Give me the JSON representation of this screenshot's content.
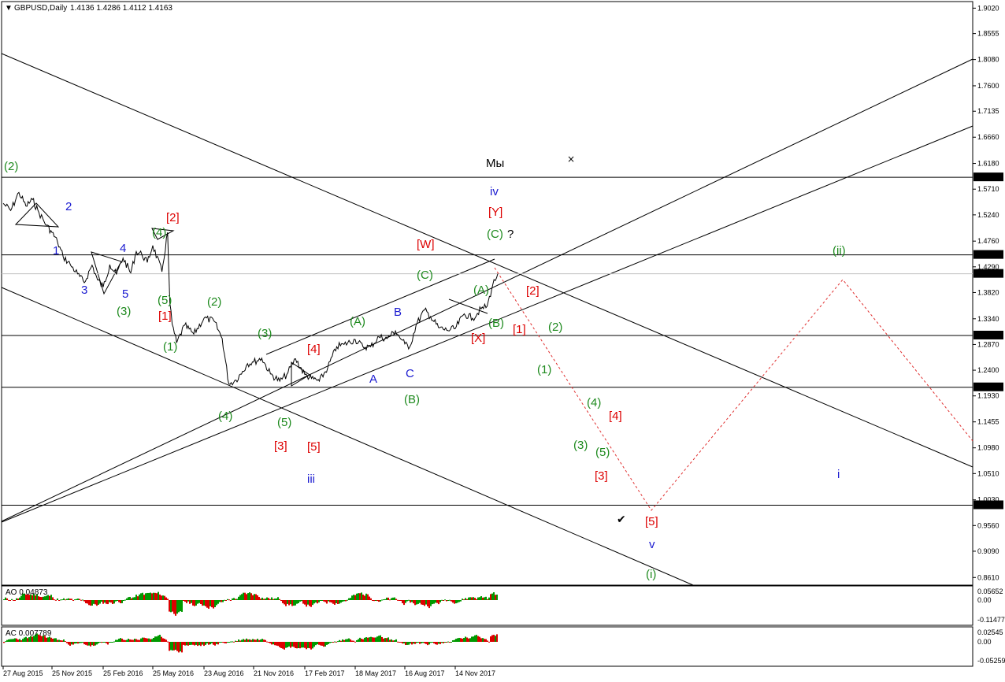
{
  "header": {
    "symbol": "GBPUSD,Daily",
    "ohlc": "1.4136 1.4286 1.4112 1.4163"
  },
  "colors": {
    "price_line": "#000000",
    "bullish_bar": "#009900",
    "bearish_bar": "#dd0000",
    "label_green": "#1e8a1e",
    "label_red": "#dd0000",
    "label_blue": "#1a1ad0",
    "forecast_line": "#e03030",
    "marker_bg": "#000000",
    "marker_text": "#ffffff"
  },
  "chart_data": {
    "type": "line",
    "title": "GBPUSD,Daily",
    "yaxis": {
      "range": [
        0.847,
        1.914
      ],
      "ticks": [
        "1.9020",
        "1.8555",
        "1.8080",
        "1.7600",
        "1.7135",
        "1.6660",
        "1.6180",
        "1.5710",
        "1.5240",
        "1.4760",
        "1.4290",
        "1.3820",
        "1.3340",
        "1.2870",
        "1.2400",
        "1.1930",
        "1.1455",
        "1.0980",
        "1.0510",
        "1.0030",
        "0.9560",
        "0.9090",
        "0.8610"
      ]
    },
    "xaxis": {
      "ticks": [
        "27 Aug 2015",
        "25 Nov 2015",
        "25 Feb 2016",
        "25 May 2016",
        "23 Aug 2016",
        "21 Nov 2016",
        "17 Feb 2017",
        "18 May 2017",
        "16 Aug 2017",
        "14 Nov 2017"
      ]
    },
    "price_series": {
      "name": "GBPUSD",
      "points": [
        [
          "27 Aug 2015",
          1.545
        ],
        [
          "10 Sep 2015",
          1.532
        ],
        [
          "25 Sep 2015",
          1.565
        ],
        [
          "08 Oct 2015",
          1.54
        ],
        [
          "20 Oct 2015",
          1.552
        ],
        [
          "01 Nov 2015",
          1.528
        ],
        [
          "15 Nov 2015",
          1.505
        ],
        [
          "25 Nov 2015",
          1.492
        ],
        [
          "05 Dec 2015",
          1.474
        ],
        [
          "15 Dec 2015",
          1.448
        ],
        [
          "28 Dec 2015",
          1.433
        ],
        [
          "10 Jan 2016",
          1.416
        ],
        [
          "22 Jan 2016",
          1.4
        ],
        [
          "05 Feb 2016",
          1.432
        ],
        [
          "15 Feb 2016",
          1.405
        ],
        [
          "25 Feb 2016",
          1.392
        ],
        [
          "08 Mar 2016",
          1.433
        ],
        [
          "20 Mar 2016",
          1.415
        ],
        [
          "01 Apr 2016",
          1.445
        ],
        [
          "15 Apr 2016",
          1.418
        ],
        [
          "25 Apr 2016",
          1.457
        ],
        [
          "05 May 2016",
          1.452
        ],
        [
          "15 May 2016",
          1.437
        ],
        [
          "25 May 2016",
          1.468
        ],
        [
          "10 Jun 2016",
          1.42
        ],
        [
          "20 Jun 2016",
          1.492
        ],
        [
          "24 Jun 2016",
          1.362
        ],
        [
          "28 Jun 2016",
          1.324
        ],
        [
          "06 Jul 2016",
          1.29
        ],
        [
          "20 Jul 2016",
          1.322
        ],
        [
          "05 Aug 2016",
          1.306
        ],
        [
          "23 Aug 2016",
          1.335
        ],
        [
          "10 Sep 2016",
          1.33
        ],
        [
          "25 Sep 2016",
          1.298
        ],
        [
          "07 Oct 2016",
          1.215
        ],
        [
          "20 Oct 2016",
          1.222
        ],
        [
          "01 Nov 2016",
          1.238
        ],
        [
          "10 Nov 2016",
          1.252
        ],
        [
          "21 Nov 2016",
          1.255
        ],
        [
          "05 Dec 2016",
          1.262
        ],
        [
          "20 Dec 2016",
          1.233
        ],
        [
          "05 Jan 2017",
          1.22
        ],
        [
          "17 Jan 2017",
          1.232
        ],
        [
          "01 Feb 2017",
          1.261
        ],
        [
          "17 Feb 2017",
          1.232
        ],
        [
          "01 Mar 2017",
          1.225
        ],
        [
          "15 Mar 2017",
          1.22
        ],
        [
          "30 Mar 2017",
          1.245
        ],
        [
          "15 Apr 2017",
          1.283
        ],
        [
          "28 Apr 2017",
          1.287
        ],
        [
          "18 May 2017",
          1.296
        ],
        [
          "01 Jun 2017",
          1.283
        ],
        [
          "15 Jun 2017",
          1.283
        ],
        [
          "30 Jun 2017",
          1.301
        ],
        [
          "15 Jul 2017",
          1.298
        ],
        [
          "30 Jul 2017",
          1.312
        ],
        [
          "10 Aug 2017",
          1.296
        ],
        [
          "16 Aug 2017",
          1.288
        ],
        [
          "25 Aug 2017",
          1.283
        ],
        [
          "05 Sep 2017",
          1.322
        ],
        [
          "20 Sep 2017",
          1.35
        ],
        [
          "01 Oct 2017",
          1.338
        ],
        [
          "15 Oct 2017",
          1.318
        ],
        [
          "30 Oct 2017",
          1.313
        ],
        [
          "14 Nov 2017",
          1.316
        ],
        [
          "30 Nov 2017",
          1.343
        ],
        [
          "15 Dec 2017",
          1.335
        ],
        [
          "30 Dec 2017",
          1.352
        ],
        [
          "10 Jan 2018",
          1.357
        ],
        [
          "20 Jan 2018",
          1.396
        ],
        [
          "29 Jan 2018",
          1.4163
        ]
      ]
    },
    "levels": [
      "1.5927",
      "1.4509",
      "1.4163",
      "1.3035",
      "1.2088",
      "0.9932"
    ],
    "indicators": [
      {
        "name": "AO",
        "value": "0.04873",
        "ticks": [
          "0.05652",
          "0.00",
          "-0.11477"
        ]
      },
      {
        "name": "AC",
        "value": "0.007789",
        "ticks": [
          "0.02545",
          "0.00",
          "-0.05259"
        ]
      }
    ],
    "annotations": [
      {
        "text": "(2)",
        "color": "green"
      },
      {
        "text": "2",
        "color": "blue"
      },
      {
        "text": "1",
        "color": "blue"
      },
      {
        "text": "3",
        "color": "blue"
      },
      {
        "text": "4",
        "color": "blue"
      },
      {
        "text": "5",
        "color": "blue"
      },
      {
        "text": "(3)",
        "color": "green"
      },
      {
        "text": "(4)",
        "color": "green"
      },
      {
        "text": "[2]",
        "color": "red"
      },
      {
        "text": "(5)",
        "color": "green"
      },
      {
        "text": "[1]",
        "color": "red"
      },
      {
        "text": "(1)",
        "color": "green"
      },
      {
        "text": "(2)",
        "color": "green"
      },
      {
        "text": "(3)",
        "color": "green"
      },
      {
        "text": "(4)",
        "color": "green"
      },
      {
        "text": "(5)",
        "color": "green"
      },
      {
        "text": "[3]",
        "color": "red"
      },
      {
        "text": "[5]",
        "color": "red"
      },
      {
        "text": "[4]",
        "color": "red"
      },
      {
        "text": "iii",
        "color": "blue"
      },
      {
        "text": "(A)",
        "color": "green"
      },
      {
        "text": "A",
        "color": "blue"
      },
      {
        "text": "B",
        "color": "blue"
      },
      {
        "text": "C",
        "color": "blue"
      },
      {
        "text": "(B)",
        "color": "green"
      },
      {
        "text": "(C)",
        "color": "green"
      },
      {
        "text": "[W]",
        "color": "red"
      },
      {
        "text": "(A)",
        "color": "green"
      },
      {
        "text": "(B)",
        "color": "green"
      },
      {
        "text": "[X]",
        "color": "red"
      },
      {
        "text": "Мы",
        "color": "black"
      },
      {
        "text": "iv",
        "color": "blue"
      },
      {
        "text": "[Y]",
        "color": "red"
      },
      {
        "text": "(C)",
        "color": "green"
      },
      {
        "text": "?",
        "color": "black"
      },
      {
        "text": "[2]",
        "color": "red"
      },
      {
        "text": "[1]",
        "color": "red"
      },
      {
        "text": "(2)",
        "color": "green"
      },
      {
        "text": "(1)",
        "color": "green"
      },
      {
        "text": "(4)",
        "color": "green"
      },
      {
        "text": "[4]",
        "color": "red"
      },
      {
        "text": "(3)",
        "color": "green"
      },
      {
        "text": "(5)",
        "color": "green"
      },
      {
        "text": "[3]",
        "color": "red"
      },
      {
        "text": "[5]",
        "color": "red"
      },
      {
        "text": "v",
        "color": "blue"
      },
      {
        "text": "(i)",
        "color": "green"
      },
      {
        "text": "(ii)",
        "color": "green"
      },
      {
        "text": "i",
        "color": "blue"
      }
    ]
  }
}
